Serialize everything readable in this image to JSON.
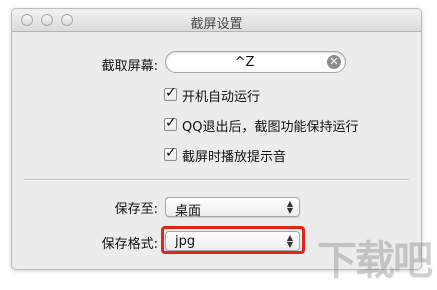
{
  "window": {
    "title": "截屏设置"
  },
  "shortcut": {
    "label": "截取屏幕:",
    "value": "^Z"
  },
  "options": [
    {
      "label": "开机自动运行",
      "checked": true
    },
    {
      "label": "QQ退出后，截图功能保持运行",
      "checked": true
    },
    {
      "label": "截屏时播放提示音",
      "checked": true
    }
  ],
  "save_to": {
    "label": "保存至:",
    "selected": "桌面"
  },
  "save_format": {
    "label": "保存格式:",
    "selected": "jpg"
  },
  "icons": {
    "clear": "clear-icon",
    "check": "checkmark-icon",
    "select_arrows": "up-down-arrows-icon"
  },
  "colors": {
    "highlight": "#e0251b"
  },
  "watermark": {
    "text": "下载吧"
  }
}
